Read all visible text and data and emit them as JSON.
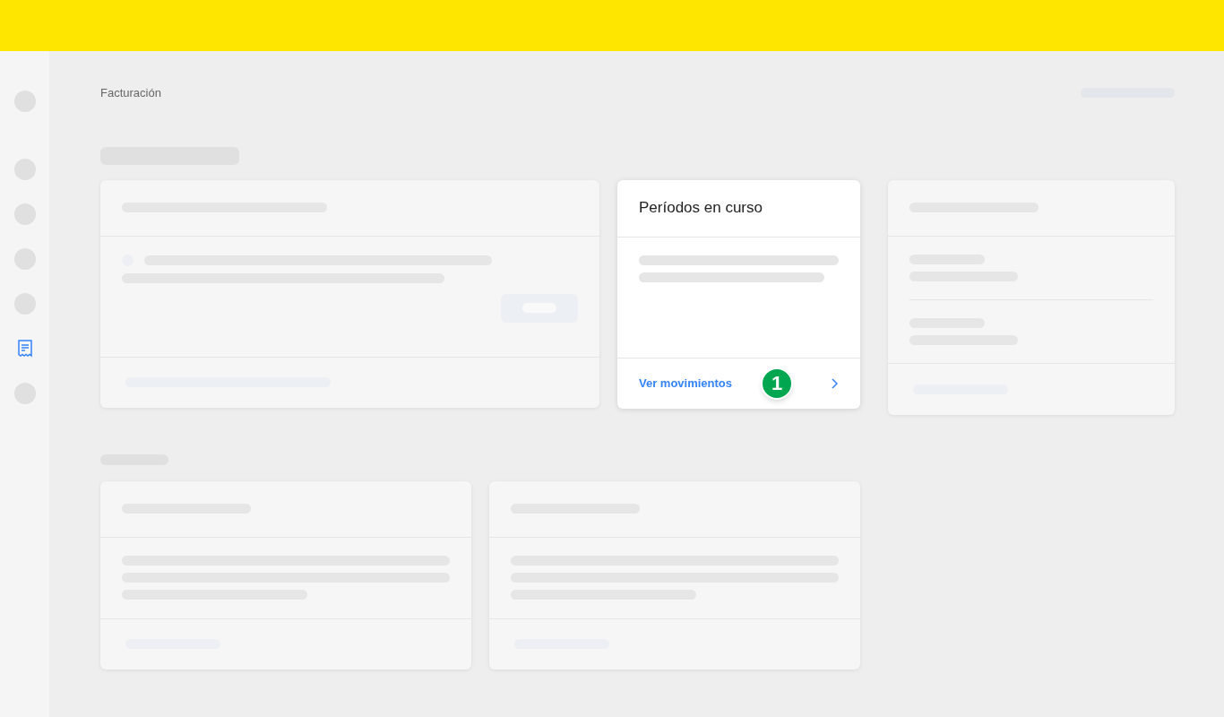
{
  "sidebar": {
    "items": [
      {
        "kind": "placeholder"
      },
      {
        "kind": "placeholder"
      },
      {
        "kind": "placeholder"
      },
      {
        "kind": "placeholder"
      },
      {
        "kind": "placeholder"
      },
      {
        "kind": "receipt",
        "selected": true
      },
      {
        "kind": "placeholder"
      }
    ]
  },
  "breadcrumb": "Facturación",
  "periods_card": {
    "title": "Períodos en curso",
    "link": "Ver movimientos",
    "badge": "1"
  }
}
